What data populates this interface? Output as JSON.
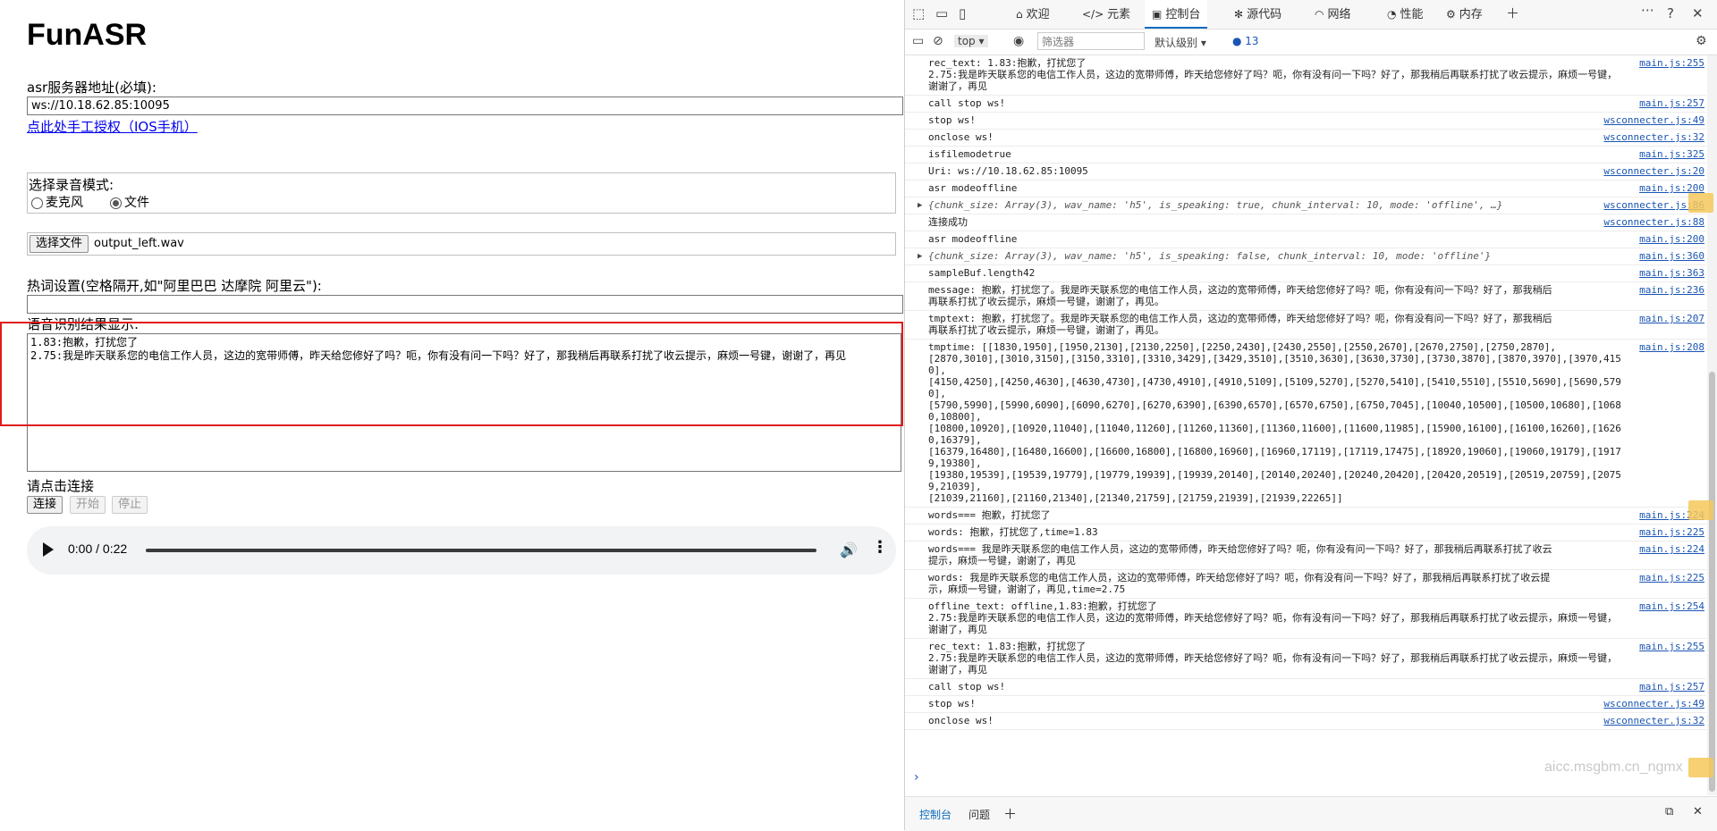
{
  "page": {
    "title": "FunASR",
    "server_label": "asr服务器地址(必填):",
    "server_value": "ws://10.18.62.85:10095",
    "auth_link": "点此处手工授权（IOS手机）",
    "mode_label": "选择录音模式:",
    "mode_mic": "麦克风",
    "mode_file": "文件",
    "file_button": "选择文件",
    "file_name": "output_left.wav",
    "hotword_label": "热词设置(空格隔开,如\"阿里巴巴 达摩院 阿里云\"):",
    "hotword_value": "",
    "result_label": "语音识别结果显示:",
    "result_text": "1.83:抱歉，打扰您了\n2.75:我是昨天联系您的电信工作人员，这边的宽带师傅，昨天给您修好了吗？呃，你有没有问一下吗？好了，那我稍后再联系打扰了收云提示，麻烦一号键，谢谢了，再见",
    "status_text": "请点击连接",
    "btn_connect": "连接",
    "btn_start": "开始",
    "btn_stop": "停止",
    "audio_time": "0:00 / 0:22"
  },
  "devtools": {
    "tabs": [
      {
        "label": "欢迎",
        "icon": "home-icon"
      },
      {
        "label": "元素",
        "icon": "code-icon"
      },
      {
        "label": "控制台",
        "icon": "console-icon"
      },
      {
        "label": "源代码",
        "icon": "bug-icon"
      },
      {
        "label": "网络",
        "icon": "wifi-icon"
      },
      {
        "label": "性能",
        "icon": "gauge-icon"
      },
      {
        "label": "内存",
        "icon": "gear-icon"
      }
    ],
    "context": "top",
    "filter_placeholder": "筛选器",
    "level": "默认级别",
    "issue_count": "13",
    "drawer_tabs": [
      "控制台",
      "问题"
    ],
    "watermark": "aicc.msgbm.cn_ngmx",
    "console_rows": [
      {
        "msg": "rec_text: 1.83:抱歉，打扰您了\n2.75:我是昨天联系您的电信工作人员，这边的宽带师傅，昨天给您修好了吗？呃，你有没有问一下吗？好了，那我稍后再联系打扰了收云提示，麻烦一号键，\n谢谢了，再见",
        "src": "main.js:255"
      },
      {
        "msg": "call stop ws!",
        "src": "main.js:257"
      },
      {
        "msg": "stop ws!",
        "src": "wsconnecter.js:49"
      },
      {
        "msg": "onclose ws!",
        "src": "wsconnecter.js:32"
      },
      {
        "msg": "isfilemodetrue",
        "src": "main.js:325"
      },
      {
        "msg": "Uri: ws://10.18.62.85:10095",
        "src": "wsconnecter.js:20"
      },
      {
        "msg": "asr modeoffline",
        "src": "main.js:200"
      },
      {
        "msg": "{chunk_size: Array(3), wav_name: 'h5', is_speaking: true, chunk_interval: 10, mode: 'offline', …}",
        "src": "wsconnecter.js:86",
        "obj": true
      },
      {
        "msg": "连接成功",
        "src": "wsconnecter.js:88"
      },
      {
        "msg": "asr modeoffline",
        "src": "main.js:200"
      },
      {
        "msg": "{chunk_size: Array(3), wav_name: 'h5', is_speaking: false, chunk_interval: 10, mode: 'offline'}",
        "src": "main.js:360",
        "obj": true
      },
      {
        "msg": "sampleBuf.length42",
        "src": "main.js:363"
      },
      {
        "msg": "message: 抱歉，打扰您了。我是昨天联系您的电信工作人员，这边的宽带师傅，昨天给您修好了吗？呃，你有没有问一下吗？好了，那我稍后\n再联系打扰了收云提示，麻烦一号键，谢谢了，再见。",
        "src": "main.js:236"
      },
      {
        "msg": "tmptext: 抱歉，打扰您了。我是昨天联系您的电信工作人员，这边的宽带师傅，昨天给您修好了吗？呃，你有没有问一下吗？好了，那我稍后\n再联系打扰了收云提示，麻烦一号键，谢谢了，再见。",
        "src": "main.js:207"
      },
      {
        "msg": "tmptime: [[1830,1950],[1950,2130],[2130,2250],[2250,2430],[2430,2550],[2550,2670],[2670,2750],[2750,2870],\n[2870,3010],[3010,3150],[3150,3310],[3310,3429],[3429,3510],[3510,3630],[3630,3730],[3730,3870],[3870,3970],[3970,4150],\n[4150,4250],[4250,4630],[4630,4730],[4730,4910],[4910,5109],[5109,5270],[5270,5410],[5410,5510],[5510,5690],[5690,5790],\n[5790,5990],[5990,6090],[6090,6270],[6270,6390],[6390,6570],[6570,6750],[6750,7045],[10040,10500],[10500,10680],[10680,10800],\n[10800,10920],[10920,11040],[11040,11260],[11260,11360],[11360,11600],[11600,11985],[15900,16100],[16100,16260],[16260,16379],\n[16379,16480],[16480,16600],[16600,16800],[16800,16960],[16960,17119],[17119,17475],[18920,19060],[19060,19179],[19179,19380],\n[19380,19539],[19539,19779],[19779,19939],[19939,20140],[20140,20240],[20240,20420],[20420,20519],[20519,20759],[20759,21039],\n[21039,21160],[21160,21340],[21340,21759],[21759,21939],[21939,22265]]",
        "src": "main.js:208"
      },
      {
        "msg": "words=== 抱歉，打扰您了",
        "src": "main.js:224"
      },
      {
        "msg": "words: 抱歉，打扰您了,time=1.83",
        "src": "main.js:225"
      },
      {
        "msg": "words=== 我是昨天联系您的电信工作人员，这边的宽带师傅，昨天给您修好了吗？呃，你有没有问一下吗？好了，那我稍后再联系打扰了收云\n提示，麻烦一号键，谢谢了，再见",
        "src": "main.js:224"
      },
      {
        "msg": "words: 我是昨天联系您的电信工作人员，这边的宽带师傅，昨天给您修好了吗？呃，你有没有问一下吗？好了，那我稍后再联系打扰了收云提\n示，麻烦一号键，谢谢了，再见,time=2.75",
        "src": "main.js:225"
      },
      {
        "msg": "offline_text: offline,1.83:抱歉，打扰您了\n2.75:我是昨天联系您的电信工作人员，这边的宽带师傅，昨天给您修好了吗？呃，你有没有问一下吗？好了，那我稍后再联系打扰了收云提示，麻烦一号键，\n谢谢了，再见",
        "src": "main.js:254"
      },
      {
        "msg": "rec_text: 1.83:抱歉，打扰您了\n2.75:我是昨天联系您的电信工作人员，这边的宽带师傅，昨天给您修好了吗？呃，你有没有问一下吗？好了，那我稍后再联系打扰了收云提示，麻烦一号键，\n谢谢了，再见",
        "src": "main.js:255"
      },
      {
        "msg": "call stop ws!",
        "src": "main.js:257"
      },
      {
        "msg": "stop ws!",
        "src": "wsconnecter.js:49"
      },
      {
        "msg": "onclose ws!",
        "src": "wsconnecter.js:32"
      }
    ]
  }
}
